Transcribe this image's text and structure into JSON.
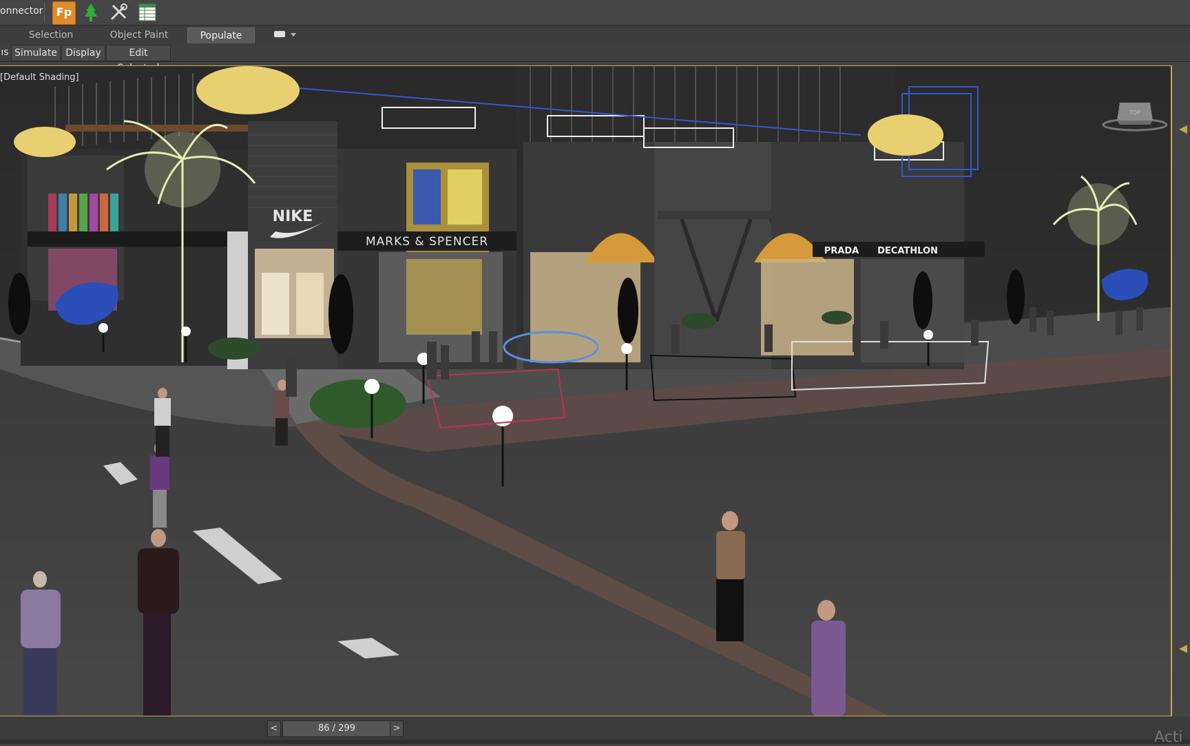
{
  "toolbar": {
    "cut_label": "onnector",
    "icons": [
      "freeform-icon",
      "populate-tree-icon",
      "tools-icon",
      "table-icon"
    ]
  },
  "ribbon": {
    "tabs": [
      {
        "label": "Selection",
        "active": false
      },
      {
        "label": "Object Paint",
        "active": false
      },
      {
        "label": "Populate",
        "active": true
      }
    ]
  },
  "subbar": {
    "cut_label": "ıs",
    "buttons": [
      "Simulate",
      "Display",
      "Edit Selected"
    ]
  },
  "viewport": {
    "label": "[Default Shading]",
    "viewcube_label": "TOP",
    "signs": [
      "NIKE",
      "MARKS & SPENCER",
      "PRADA",
      "DECATHLON"
    ]
  },
  "timeline": {
    "frame_text": "86 / 299",
    "prev": "<",
    "next": ">"
  },
  "watermark": "Acti",
  "colors": {
    "toolbar_bg": "#454545",
    "accent_frame": "#c8a84a",
    "fp_icon": "#e08a2a"
  }
}
